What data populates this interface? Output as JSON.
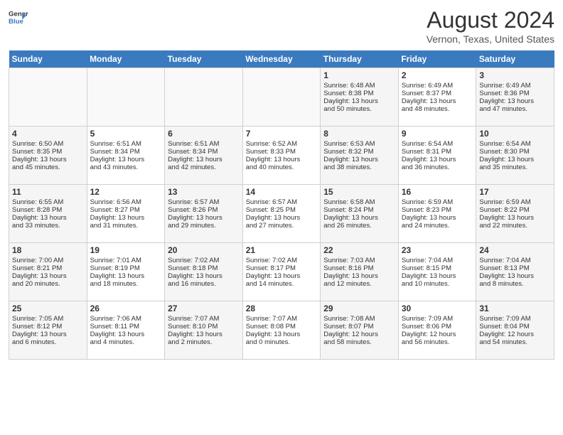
{
  "header": {
    "logo_line1": "General",
    "logo_line2": "Blue",
    "title": "August 2024",
    "subtitle": "Vernon, Texas, United States"
  },
  "days_of_week": [
    "Sunday",
    "Monday",
    "Tuesday",
    "Wednesday",
    "Thursday",
    "Friday",
    "Saturday"
  ],
  "weeks": [
    [
      {
        "day": "",
        "info": ""
      },
      {
        "day": "",
        "info": ""
      },
      {
        "day": "",
        "info": ""
      },
      {
        "day": "",
        "info": ""
      },
      {
        "day": "1",
        "info": "Sunrise: 6:48 AM\nSunset: 8:38 PM\nDaylight: 13 hours\nand 50 minutes."
      },
      {
        "day": "2",
        "info": "Sunrise: 6:49 AM\nSunset: 8:37 PM\nDaylight: 13 hours\nand 48 minutes."
      },
      {
        "day": "3",
        "info": "Sunrise: 6:49 AM\nSunset: 8:36 PM\nDaylight: 13 hours\nand 47 minutes."
      }
    ],
    [
      {
        "day": "4",
        "info": "Sunrise: 6:50 AM\nSunset: 8:35 PM\nDaylight: 13 hours\nand 45 minutes."
      },
      {
        "day": "5",
        "info": "Sunrise: 6:51 AM\nSunset: 8:34 PM\nDaylight: 13 hours\nand 43 minutes."
      },
      {
        "day": "6",
        "info": "Sunrise: 6:51 AM\nSunset: 8:34 PM\nDaylight: 13 hours\nand 42 minutes."
      },
      {
        "day": "7",
        "info": "Sunrise: 6:52 AM\nSunset: 8:33 PM\nDaylight: 13 hours\nand 40 minutes."
      },
      {
        "day": "8",
        "info": "Sunrise: 6:53 AM\nSunset: 8:32 PM\nDaylight: 13 hours\nand 38 minutes."
      },
      {
        "day": "9",
        "info": "Sunrise: 6:54 AM\nSunset: 8:31 PM\nDaylight: 13 hours\nand 36 minutes."
      },
      {
        "day": "10",
        "info": "Sunrise: 6:54 AM\nSunset: 8:30 PM\nDaylight: 13 hours\nand 35 minutes."
      }
    ],
    [
      {
        "day": "11",
        "info": "Sunrise: 6:55 AM\nSunset: 8:28 PM\nDaylight: 13 hours\nand 33 minutes."
      },
      {
        "day": "12",
        "info": "Sunrise: 6:56 AM\nSunset: 8:27 PM\nDaylight: 13 hours\nand 31 minutes."
      },
      {
        "day": "13",
        "info": "Sunrise: 6:57 AM\nSunset: 8:26 PM\nDaylight: 13 hours\nand 29 minutes."
      },
      {
        "day": "14",
        "info": "Sunrise: 6:57 AM\nSunset: 8:25 PM\nDaylight: 13 hours\nand 27 minutes."
      },
      {
        "day": "15",
        "info": "Sunrise: 6:58 AM\nSunset: 8:24 PM\nDaylight: 13 hours\nand 26 minutes."
      },
      {
        "day": "16",
        "info": "Sunrise: 6:59 AM\nSunset: 8:23 PM\nDaylight: 13 hours\nand 24 minutes."
      },
      {
        "day": "17",
        "info": "Sunrise: 6:59 AM\nSunset: 8:22 PM\nDaylight: 13 hours\nand 22 minutes."
      }
    ],
    [
      {
        "day": "18",
        "info": "Sunrise: 7:00 AM\nSunset: 8:21 PM\nDaylight: 13 hours\nand 20 minutes."
      },
      {
        "day": "19",
        "info": "Sunrise: 7:01 AM\nSunset: 8:19 PM\nDaylight: 13 hours\nand 18 minutes."
      },
      {
        "day": "20",
        "info": "Sunrise: 7:02 AM\nSunset: 8:18 PM\nDaylight: 13 hours\nand 16 minutes."
      },
      {
        "day": "21",
        "info": "Sunrise: 7:02 AM\nSunset: 8:17 PM\nDaylight: 13 hours\nand 14 minutes."
      },
      {
        "day": "22",
        "info": "Sunrise: 7:03 AM\nSunset: 8:16 PM\nDaylight: 13 hours\nand 12 minutes."
      },
      {
        "day": "23",
        "info": "Sunrise: 7:04 AM\nSunset: 8:15 PM\nDaylight: 13 hours\nand 10 minutes."
      },
      {
        "day": "24",
        "info": "Sunrise: 7:04 AM\nSunset: 8:13 PM\nDaylight: 13 hours\nand 8 minutes."
      }
    ],
    [
      {
        "day": "25",
        "info": "Sunrise: 7:05 AM\nSunset: 8:12 PM\nDaylight: 13 hours\nand 6 minutes."
      },
      {
        "day": "26",
        "info": "Sunrise: 7:06 AM\nSunset: 8:11 PM\nDaylight: 13 hours\nand 4 minutes."
      },
      {
        "day": "27",
        "info": "Sunrise: 7:07 AM\nSunset: 8:10 PM\nDaylight: 13 hours\nand 2 minutes."
      },
      {
        "day": "28",
        "info": "Sunrise: 7:07 AM\nSunset: 8:08 PM\nDaylight: 13 hours\nand 0 minutes."
      },
      {
        "day": "29",
        "info": "Sunrise: 7:08 AM\nSunset: 8:07 PM\nDaylight: 12 hours\nand 58 minutes."
      },
      {
        "day": "30",
        "info": "Sunrise: 7:09 AM\nSunset: 8:06 PM\nDaylight: 12 hours\nand 56 minutes."
      },
      {
        "day": "31",
        "info": "Sunrise: 7:09 AM\nSunset: 8:04 PM\nDaylight: 12 hours\nand 54 minutes."
      }
    ]
  ]
}
